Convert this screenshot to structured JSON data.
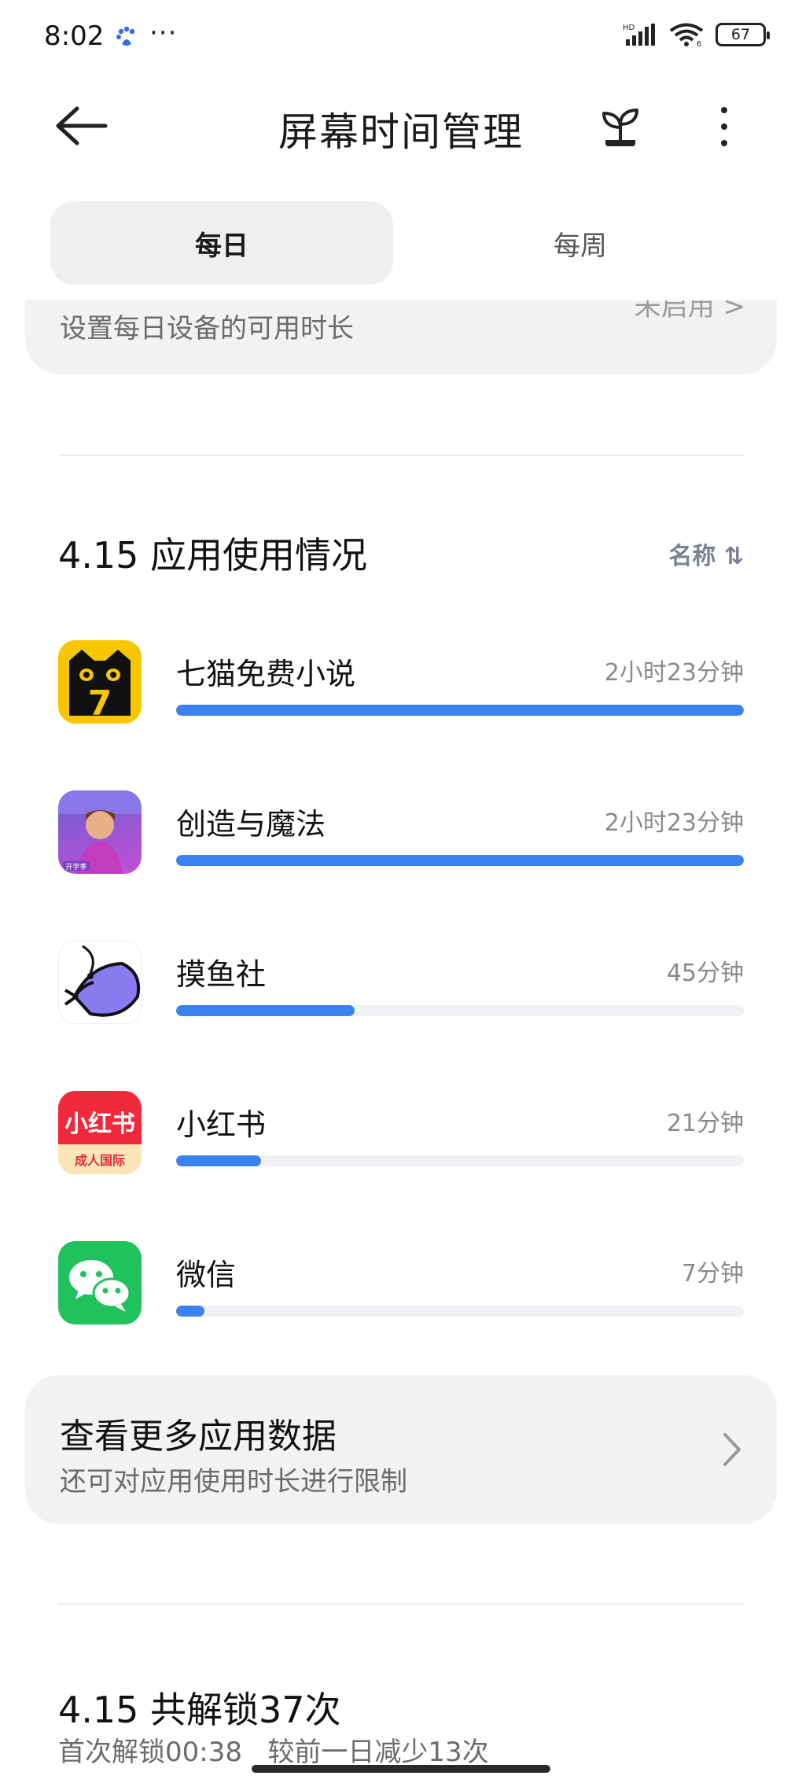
{
  "status_bar": {
    "time": "8:02",
    "more": "···",
    "network": "HD",
    "wifi_label": "6",
    "battery": "67"
  },
  "app_bar": {
    "title": "屏幕时间管理"
  },
  "tabs": [
    {
      "label": "每日",
      "selected": true
    },
    {
      "label": "每周",
      "selected": false
    }
  ],
  "limit_card": {
    "subtitle": "设置每日设备的可用时长",
    "status": "未启用 >"
  },
  "usage": {
    "title": "4.15 应用使用情况",
    "sort_label": "名称 ⇅",
    "apps": [
      {
        "name": "七猫免费小说",
        "time": "2小时23分钟",
        "fraction": 1.0
      },
      {
        "name": "创造与魔法",
        "time": "2小时23分钟",
        "fraction": 1.0
      },
      {
        "name": "摸鱼社",
        "time": "45分钟",
        "fraction": 0.315
      },
      {
        "name": "小红书",
        "time": "21分钟",
        "fraction": 0.15
      },
      {
        "name": "微信",
        "time": "7分钟",
        "fraction": 0.05
      }
    ],
    "icons": {
      "qimao_badge": "7",
      "chuangzao_badge": "开学季",
      "xhs_title": "小红书",
      "xhs_sub": "成人国际"
    }
  },
  "more_card": {
    "title": "查看更多应用数据",
    "subtitle": "还可对应用使用时长进行限制"
  },
  "unlock": {
    "title": "4.15 共解锁37次",
    "subtitle": "首次解锁00:38   较前一日减少13次"
  },
  "colors": {
    "accent": "#3b82f1",
    "card_bg": "#f2f2f2",
    "track": "#eff1f5"
  }
}
